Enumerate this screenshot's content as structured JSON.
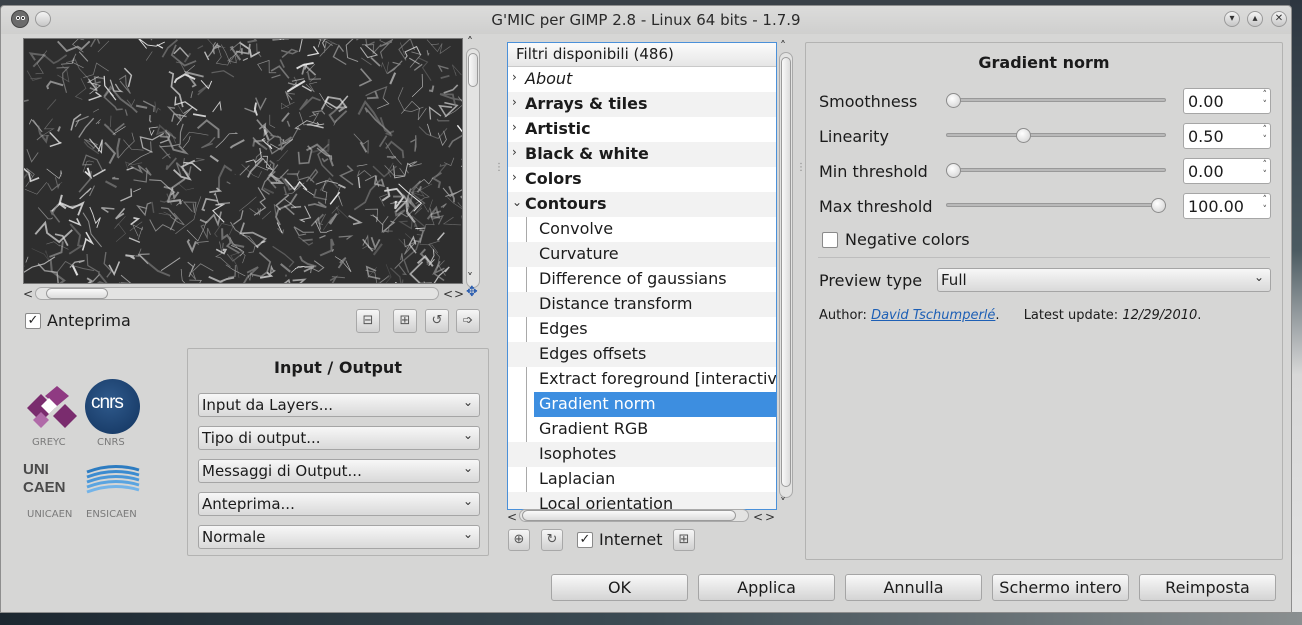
{
  "window": {
    "title": "G'MIC per GIMP 2.8 - Linux 64 bits - 1.7.9"
  },
  "preview": {
    "checkbox_label": "Anteprima",
    "checked": true
  },
  "io": {
    "title": "Input / Output",
    "combos": [
      "Input da Layers...",
      "Tipo di output...",
      "Messaggi di Output...",
      "Anteprima...",
      "Normale"
    ]
  },
  "logos": {
    "greyc": "GREYC",
    "cnrs": "CNRS",
    "cnrs_mark": "cnrs",
    "unicaen": "UNICAEN",
    "unicaen_mark": "UNI CAEN",
    "ensicaen": "ENSICAEN"
  },
  "filters": {
    "header": "Filtri disponibili (486)",
    "categories": [
      {
        "label": "About",
        "style": "italic"
      },
      {
        "label": "Arrays & tiles",
        "style": "bold"
      },
      {
        "label": "Artistic",
        "style": "bold"
      },
      {
        "label": "Black & white",
        "style": "bold"
      },
      {
        "label": "Colors",
        "style": "bold"
      },
      {
        "label": "Contours",
        "style": "bold",
        "expanded": true
      }
    ],
    "items": [
      "Convolve",
      "Curvature",
      "Difference of gaussians",
      "Distance transform",
      "Edges",
      "Edges offsets",
      "Extract foreground [interactive",
      "Gradient norm",
      "Gradient RGB",
      "Isophotes",
      "Laplacian",
      "Local orientation"
    ],
    "selected": "Gradient norm",
    "internet_label": "Internet",
    "internet_checked": true
  },
  "params": {
    "title": "Gradient norm",
    "sliders": [
      {
        "label": "Smoothness",
        "value": "0.00",
        "fraction": 0.0
      },
      {
        "label": "Linearity",
        "value": "0.50",
        "fraction": 0.34
      },
      {
        "label": "Min threshold",
        "value": "0.00",
        "fraction": 0.0
      },
      {
        "label": "Max threshold",
        "value": "100.00",
        "fraction": 1.0
      }
    ],
    "negative_label": "Negative colors",
    "negative_checked": false,
    "preview_type_label": "Preview type",
    "preview_type_value": "Full",
    "author_label": "Author:",
    "author_name": "David Tschumperlé",
    "author_dot": ".",
    "update_label": "Latest update:",
    "update_value": "12/29/2010",
    "update_dot": "."
  },
  "buttons": {
    "ok": "OK",
    "apply": "Applica",
    "cancel": "Annulla",
    "fullscreen": "Schermo intero",
    "reset": "Reimposta"
  }
}
